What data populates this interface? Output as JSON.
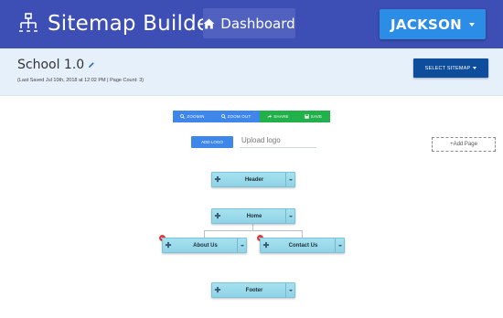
{
  "header": {
    "app_title": "Sitemap Builder",
    "logo_icon": "sitemap-icon",
    "dashboard_label": "Dashboard",
    "dashboard_icon": "home-icon",
    "user_label": "JACKSON"
  },
  "project": {
    "title": "School 1.0",
    "meta": "(Last Saved Jul 10th, 2018 at 12:02 PM | Page Count: 3)",
    "select_sitemap_label": "SELECT SITEMAP"
  },
  "toolbar": {
    "zoom_in": "ZOOMIN",
    "zoom_out": "ZOOM OUT",
    "share": "SHARE",
    "save": "SAVE",
    "add_logo": "ADD LOGO",
    "upload_placeholder": "Upload logo",
    "add_page": "+Add Page"
  },
  "nodes": {
    "header": "Header",
    "home": "Home",
    "about": "About Us",
    "contact": "Contact Us",
    "footer": "Footer"
  },
  "colors": {
    "nav_bg": "#3d4fb4",
    "user_btn": "#2b8de6",
    "info_bg": "#e6f0fa",
    "select_btn": "#0e4d9b",
    "node_bg": "#a6e1f0",
    "tool_blue": "#3e86ea",
    "tool_green": "#22b04a",
    "remove_red": "#e53935"
  }
}
